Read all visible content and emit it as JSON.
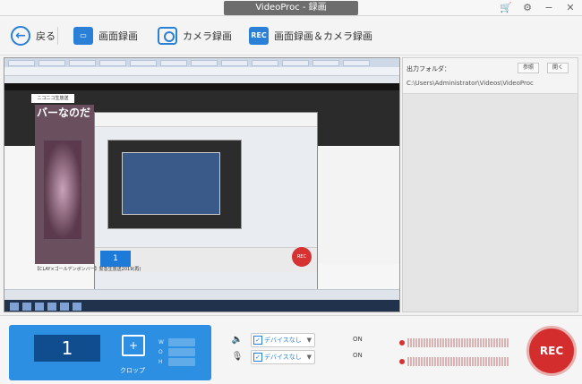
{
  "window": {
    "title": "VideoProc - 録画"
  },
  "title_icons": [
    "cart-icon",
    "gear-icon",
    "minimize-icon",
    "close-icon"
  ],
  "toolbar": {
    "back_label": "戻る",
    "screen_label": "画面録画",
    "camera_label": "カメラ録画",
    "rec_icon_text": "REC",
    "both_label": "画面録画＆カメラ録画"
  },
  "preview": {
    "nico_logo": "ニコニコ生放送",
    "big_text": "バーなのだ",
    "caption": "【CLAY×ゴールデンボンバー】緊急生放送2019(再)",
    "inner_one": "1",
    "inner_rec": "REC"
  },
  "output": {
    "label": "出力フォルダ：",
    "path": "C:\\Users\\Administrator\\Videos\\VideoProc",
    "browse_label": "参照",
    "open_label": "開く"
  },
  "bottom": {
    "monitor_number": "1",
    "crop_label": "クロップ",
    "dim_w": "W",
    "dim_o": "O",
    "dim_h": "H",
    "speaker_device": "デバイスなし",
    "mic_device": "デバイスなし",
    "speaker_state": "ON",
    "mic_state": "ON",
    "rec_label": "REC"
  },
  "colors": {
    "accent": "#2a7fd6",
    "rec": "#d32d2d"
  }
}
